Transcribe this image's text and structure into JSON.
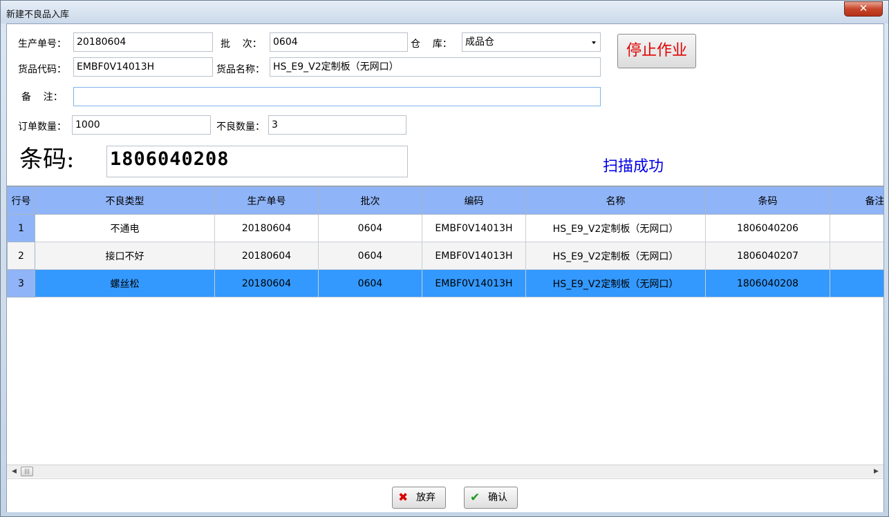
{
  "window": {
    "title": "新建不良品入库",
    "close_label": "✕"
  },
  "form": {
    "production_no_label": "生产单号：",
    "production_no": "20180604",
    "batch_label": "批    次：",
    "batch": "0604",
    "warehouse_label": "仓    库：",
    "warehouse": "成品仓",
    "goods_code_label": "货品代码：",
    "goods_code": "EMBF0V14013H",
    "goods_name_label": "货品名称：",
    "goods_name": "HS_E9_V2定制板（无网口）",
    "remark_label": "备    注：",
    "remark": "",
    "order_qty_label": "订单数量：",
    "order_qty": "1000",
    "defect_qty_label": "不良数量：",
    "defect_qty": "3",
    "stop_button": "停止作业",
    "barcode_label": "条码:",
    "barcode": "1806040208",
    "scan_status": "扫描成功"
  },
  "grid": {
    "columns": [
      "行号",
      "不良类型",
      "生产单号",
      "批次",
      "编码",
      "名称",
      "条码",
      "备注"
    ],
    "rows": [
      {
        "row_no": "1",
        "defect_type": "不通电",
        "production_no": "20180604",
        "batch": "0604",
        "code": "EMBF0V14013H",
        "name": "HS_E9_V2定制板（无网口）",
        "barcode": "1806040206",
        "remark": ""
      },
      {
        "row_no": "2",
        "defect_type": "接口不好",
        "production_no": "20180604",
        "batch": "0604",
        "code": "EMBF0V14013H",
        "name": "HS_E9_V2定制板（无网口）",
        "barcode": "1806040207",
        "remark": ""
      },
      {
        "row_no": "3",
        "defect_type": "螺丝松",
        "production_no": "20180604",
        "batch": "0604",
        "code": "EMBF0V14013H",
        "name": "HS_E9_V2定制板（无网口）",
        "barcode": "1806040208",
        "remark": ""
      }
    ],
    "selected_row": 3
  },
  "footer": {
    "abandon_label": "放弃",
    "confirm_label": "确认"
  },
  "colors": {
    "header_bg": "#8fb4f7",
    "selected_row": "#3399ff",
    "stop_text": "#e00000",
    "status_text": "#0000e6"
  }
}
